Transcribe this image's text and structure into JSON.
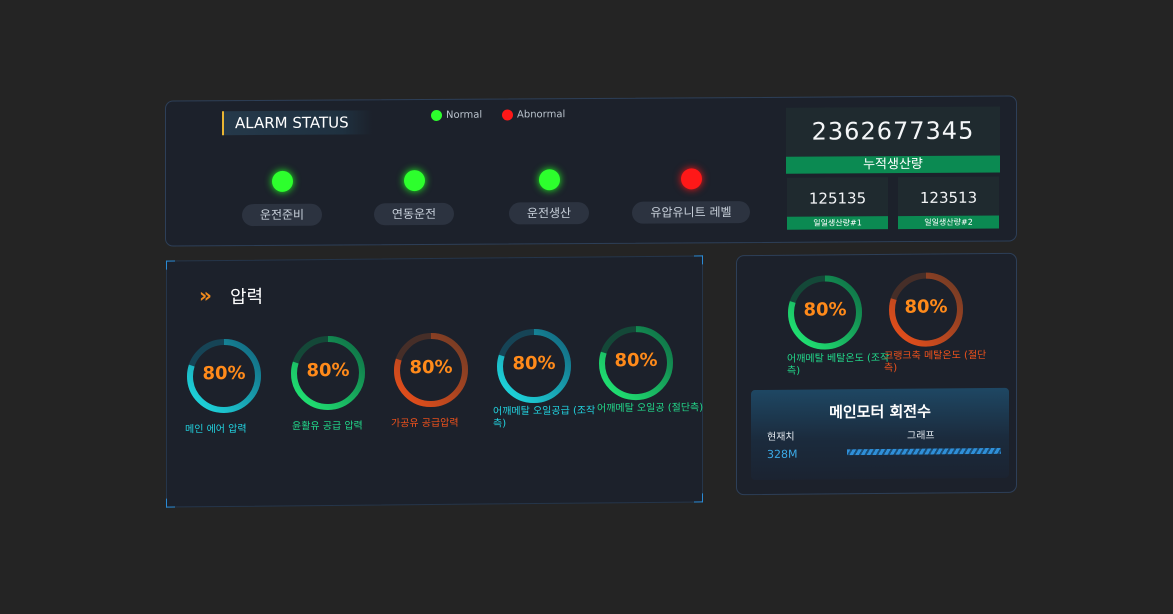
{
  "alarm": {
    "title": "ALARM STATUS",
    "legend": [
      {
        "label": "Normal",
        "color": "#2dff2d"
      },
      {
        "label": "Abnormal",
        "color": "#ff1818"
      }
    ],
    "items": [
      {
        "label": "운전준비",
        "state": "normal"
      },
      {
        "label": "연동운전",
        "state": "normal"
      },
      {
        "label": "운전생산",
        "state": "normal"
      },
      {
        "label": "유압유니트 레벨",
        "state": "abnormal"
      }
    ]
  },
  "production": {
    "total_value": "2362677345",
    "total_label": "누적생산량",
    "daily": [
      {
        "value": "125135",
        "label": "일일생산량#1"
      },
      {
        "value": "123513",
        "label": "일일생산량#2"
      }
    ]
  },
  "pressure": {
    "title": "압력",
    "chevron": "»",
    "gauges": [
      {
        "value": "80%",
        "fraction": 0.8,
        "label": "메인 에어 압력",
        "color_a": "#1fe0e6",
        "color_b": "#12627a",
        "label_color": "#22d3e0"
      },
      {
        "value": "80%",
        "fraction": 0.8,
        "label": "윤활유 공급 압력",
        "color_a": "#22ee77",
        "color_b": "#0e6a44",
        "label_color": "#22d88a"
      },
      {
        "value": "80%",
        "fraction": 0.8,
        "label": "가공유 공급압력",
        "color_a": "#f0501a",
        "color_b": "#6a3a26",
        "label_color": "#f0521c"
      },
      {
        "value": "80%",
        "fraction": 0.8,
        "label": "어깨메탈 오일공급 (조작측)",
        "color_a": "#1fe0e6",
        "color_b": "#12627a",
        "label_color": "#22d3e0"
      },
      {
        "value": "80%",
        "fraction": 0.8,
        "label": "어깨메탈 오일공 (절단측)",
        "color_a": "#22ee77",
        "color_b": "#0e6a44",
        "label_color": "#22d88a"
      }
    ]
  },
  "temperature": {
    "gauges": [
      {
        "value": "80%",
        "fraction": 0.8,
        "label": "어깨메탈 베탈온도 (조작측)",
        "color_a": "#22ee77",
        "color_b": "#0e6a44",
        "label_color": "#22d88a"
      },
      {
        "value": "80%",
        "fraction": 0.8,
        "label": "크랭크축 메탈온도 (절단측)",
        "color_a": "#f0501a",
        "color_b": "#6a3a26",
        "label_color": "#f0521c"
      }
    ]
  },
  "motor": {
    "title": "메인모터 회전수",
    "current_label": "현재치",
    "graph_label": "그래프",
    "current_value": "328M",
    "fill_fraction": 1.0
  }
}
